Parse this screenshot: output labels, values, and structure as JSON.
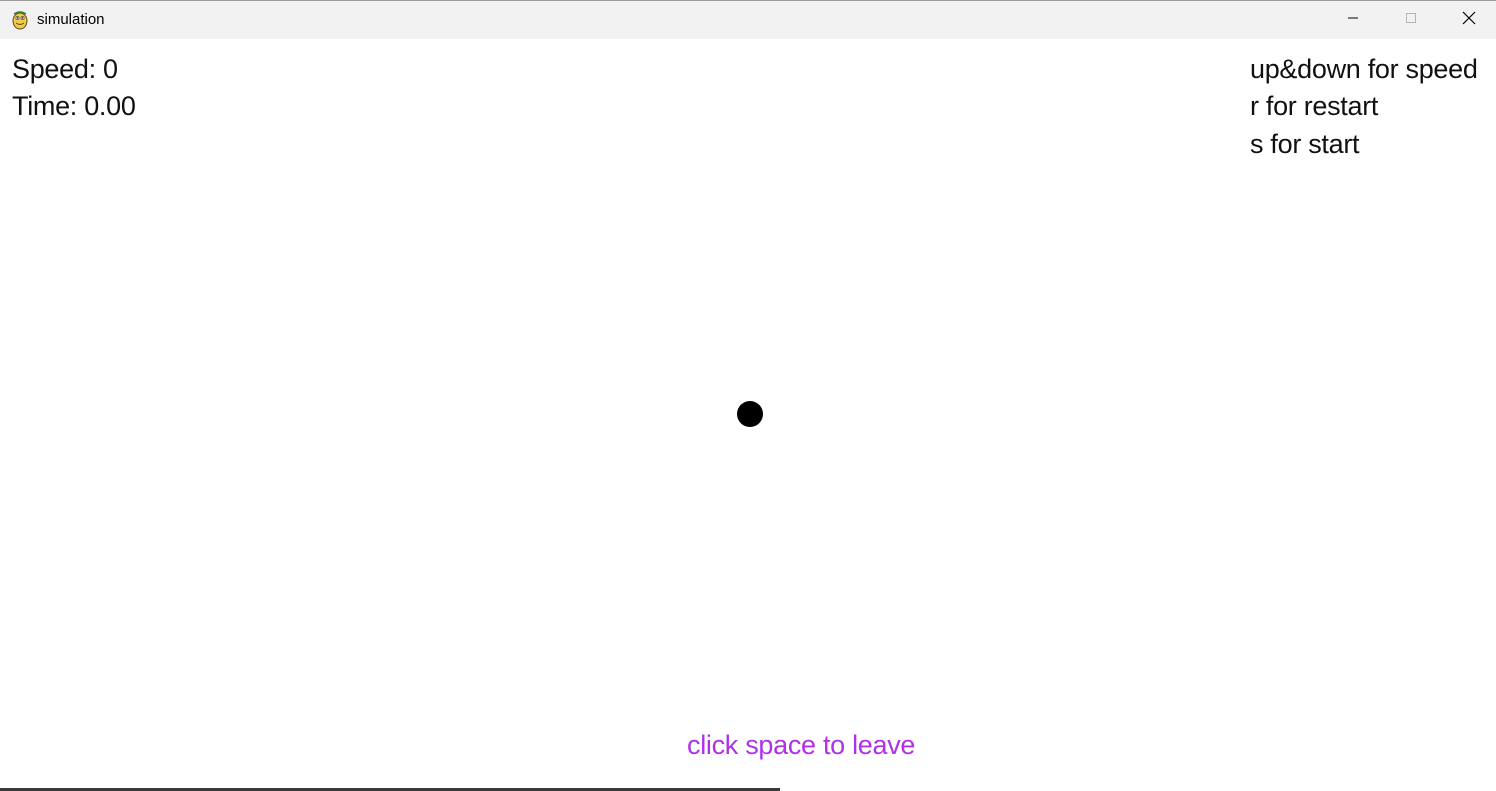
{
  "window": {
    "title": "simulation",
    "icon": "pygame-snake-icon",
    "controls": {
      "minimize_icon": "minimize-icon",
      "maximize_icon": "maximize-icon",
      "close_icon": "close-icon"
    }
  },
  "hud": {
    "speed_text": "Speed: 0",
    "time_text": "Time: 0.00"
  },
  "help": {
    "lines": [
      "up&down for speed",
      "r for restart",
      "s for start"
    ]
  },
  "footer": {
    "leave_text": "click space to leave"
  },
  "colors": {
    "background": "#ffffff",
    "text": "#111111",
    "ball": "#000000",
    "leave_text": "#b030e8",
    "titlebar": "#f2f2f2"
  }
}
